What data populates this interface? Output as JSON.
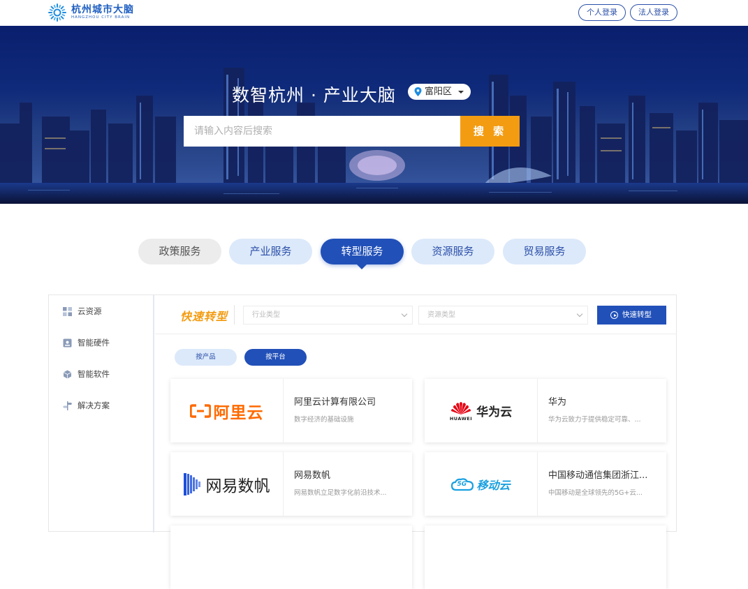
{
  "header": {
    "logo_cn": "杭州城市大脑",
    "logo_en": "HANGZHOU CITY BRAIN",
    "login_personal": "个人登录",
    "login_legal": "法人登录"
  },
  "banner": {
    "title": "数智杭州 · 产业大脑",
    "district": "富阳区",
    "search_placeholder": "请输入内容后搜索",
    "search_button": "搜 索"
  },
  "tabs": [
    {
      "label": "政策服务",
      "active": false
    },
    {
      "label": "产业服务",
      "active": false
    },
    {
      "label": "转型服务",
      "active": true
    },
    {
      "label": "资源服务",
      "active": false
    },
    {
      "label": "贸易服务",
      "active": false
    }
  ],
  "sidebar": {
    "items": [
      {
        "label": "云资源",
        "icon": "grid-icon"
      },
      {
        "label": "智能硬件",
        "icon": "hardware-icon"
      },
      {
        "label": "智能软件",
        "icon": "cube-icon"
      },
      {
        "label": "解决方案",
        "icon": "signpost-icon"
      }
    ]
  },
  "toolbar": {
    "quick_title": "快速转型",
    "industry_placeholder": "行业类型",
    "resource_placeholder": "资源类型",
    "quick_button": "快速转型"
  },
  "filters": {
    "by_product": "按产品",
    "by_platform": "按平台"
  },
  "cards": [
    {
      "logo_text": "阿里云",
      "name": "阿里云计算有限公司",
      "desc": "数字经济的基础设施"
    },
    {
      "logo_text": "华为云",
      "logo_sub": "HUAWEI",
      "name": "华为",
      "desc": "华为云致力于提供稳定可靠、..."
    },
    {
      "logo_text": "网易数帆",
      "name": "网易数帆",
      "desc": "网易数帆立足数字化前沿技术..."
    },
    {
      "logo_text": "移动云",
      "logo_sub": "5G",
      "name": "中国移动通信集团浙江...",
      "desc": "中国移动是全球领先的5G+云..."
    }
  ],
  "colors": {
    "primary": "#2150b8",
    "accent": "#f39c12",
    "light_blue": "#dce9fa",
    "aliyun_orange": "#ff6a00",
    "huawei_red": "#e60012"
  }
}
